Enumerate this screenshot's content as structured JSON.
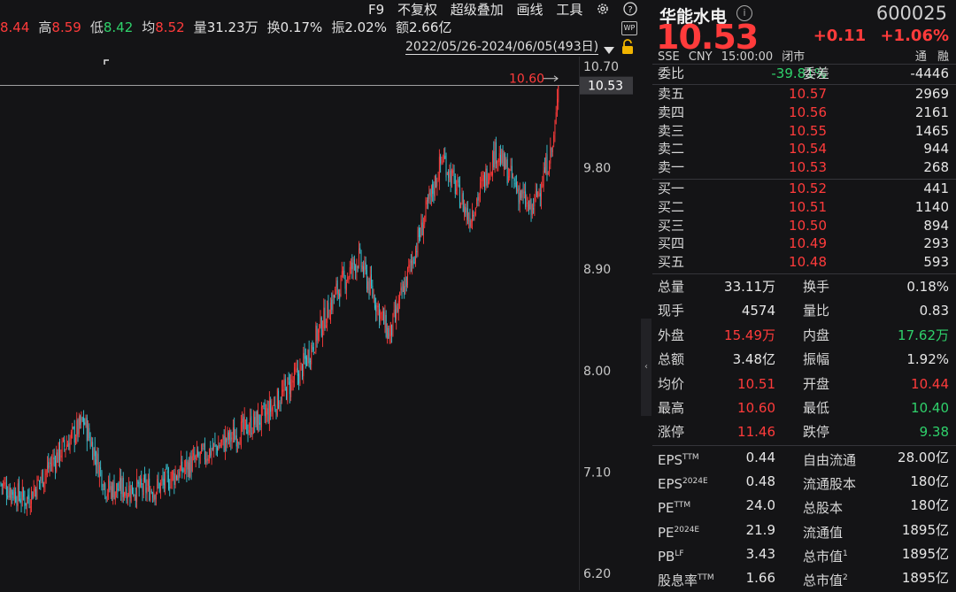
{
  "toolbar": {
    "stats": [
      {
        "label": "",
        "value": "8.44",
        "color": "up"
      },
      {
        "label": "高",
        "value": "8.59",
        "color": "up"
      },
      {
        "label": "低",
        "value": "8.42",
        "color": "down"
      },
      {
        "label": "均",
        "value": "8.52",
        "color": "up"
      },
      {
        "label": "量",
        "value": "31.23万",
        "color": "wh"
      },
      {
        "label": "换",
        "value": "0.17%",
        "color": "wh"
      },
      {
        "label": "振",
        "value": "2.02%",
        "color": "wh"
      },
      {
        "label": "额",
        "value": "2.66亿",
        "color": "wh"
      }
    ],
    "menu": [
      "F9",
      "不复权",
      "超级叠加",
      "画线",
      "工具"
    ],
    "date_range": "2022/05/26-2024/06/05(493日)",
    "wp_label": "WP"
  },
  "chart": {
    "y_ticks": [
      "10.70",
      "9.80",
      "8.90",
      "8.00",
      "7.10",
      "6.20"
    ],
    "y_min": 6.2,
    "y_max": 10.7,
    "current_price_label": "10.53",
    "max_marker_label": "10.60",
    "colors": {
      "up": "#ff3b3b",
      "down": "#39c7d6",
      "grid": "#2a2a2e",
      "axis_text": "#c8c8c8"
    }
  },
  "quote": {
    "name": "华能水电",
    "code": "600025",
    "price": "10.53",
    "change": "+0.11",
    "change_pct": "+1.06%",
    "exchange": "SSE",
    "currency": "CNY",
    "time": "15:00:00",
    "status": "闭市",
    "badges": [
      "通",
      "融"
    ],
    "wei_bi_label": "委比",
    "wei_bi": "-39.81%",
    "wei_cha_label": "委差",
    "wei_cha": "-4446"
  },
  "order_book": {
    "asks": [
      {
        "label": "卖五",
        "price": "10.57",
        "vol": "2969"
      },
      {
        "label": "卖四",
        "price": "10.56",
        "vol": "2161"
      },
      {
        "label": "卖三",
        "price": "10.55",
        "vol": "1465"
      },
      {
        "label": "卖二",
        "price": "10.54",
        "vol": "944"
      },
      {
        "label": "卖一",
        "price": "10.53",
        "vol": "268"
      }
    ],
    "bids": [
      {
        "label": "买一",
        "price": "10.52",
        "vol": "441"
      },
      {
        "label": "买二",
        "price": "10.51",
        "vol": "1140"
      },
      {
        "label": "买三",
        "price": "10.50",
        "vol": "894"
      },
      {
        "label": "买四",
        "price": "10.49",
        "vol": "293"
      },
      {
        "label": "买五",
        "price": "10.48",
        "vol": "593"
      }
    ]
  },
  "stats": [
    {
      "l1": "总量",
      "v1": "33.11万",
      "c1": "wh",
      "l2": "换手",
      "v2": "0.18%",
      "c2": "wh"
    },
    {
      "l1": "现手",
      "v1": "4574",
      "c1": "wh",
      "l2": "量比",
      "v2": "0.83",
      "c2": "wh"
    },
    {
      "l1": "外盘",
      "v1": "15.49万",
      "c1": "up",
      "l2": "内盘",
      "v2": "17.62万",
      "c2": "down"
    },
    {
      "l1": "总额",
      "v1": "3.48亿",
      "c1": "wh",
      "l2": "振幅",
      "v2": "1.92%",
      "c2": "wh"
    },
    {
      "l1": "均价",
      "v1": "10.51",
      "c1": "up",
      "l2": "开盘",
      "v2": "10.44",
      "c2": "up"
    },
    {
      "l1": "最高",
      "v1": "10.60",
      "c1": "up",
      "l2": "最低",
      "v2": "10.40",
      "c2": "down"
    },
    {
      "l1": "涨停",
      "v1": "11.46",
      "c1": "up",
      "l2": "跌停",
      "v2": "9.38",
      "c2": "down"
    }
  ],
  "fundamentals": [
    {
      "l1": "EPS",
      "s1": "TTM",
      "v1": "0.44",
      "l2": "自由流通",
      "s2": "",
      "v2": "28.00亿"
    },
    {
      "l1": "EPS",
      "s1": "2024E",
      "v1": "0.48",
      "l2": "流通股本",
      "s2": "",
      "v2": "180亿"
    },
    {
      "l1": "PE",
      "s1": "TTM",
      "v1": "24.0",
      "l2": "总股本",
      "s2": "",
      "v2": "180亿"
    },
    {
      "l1": "PE",
      "s1": "2024E",
      "v1": "21.9",
      "l2": "流通值",
      "s2": "",
      "v2": "1895亿"
    },
    {
      "l1": "PB",
      "s1": "LF",
      "v1": "3.43",
      "l2": "总市值",
      "s2": "1",
      "v2": "1895亿"
    },
    {
      "l1": "股息率",
      "s1": "TTM",
      "v1": "1.66",
      "l2": "总市值",
      "s2": "2",
      "v2": "1895亿"
    }
  ]
}
